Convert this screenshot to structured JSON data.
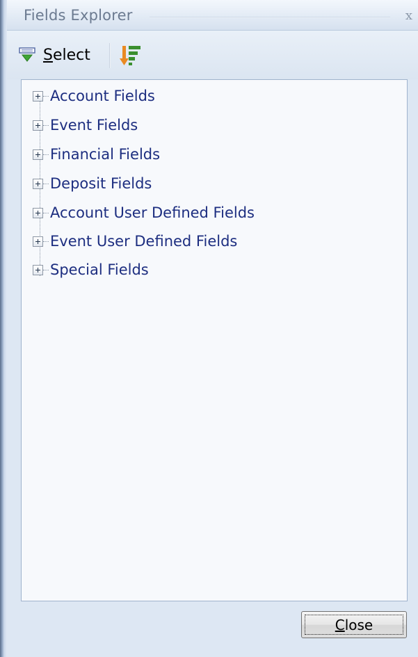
{
  "window": {
    "title": "Fields Explorer",
    "close_glyph": "x"
  },
  "toolbar": {
    "select_first": "S",
    "select_rest": "elect",
    "select_icon": "select-fields-icon",
    "sort_icon": "sort-order-icon"
  },
  "tree": {
    "items": [
      {
        "label": "Account Fields"
      },
      {
        "label": "Event Fields"
      },
      {
        "label": "Financial Fields"
      },
      {
        "label": "Deposit Fields"
      },
      {
        "label": "Account User Defined Fields"
      },
      {
        "label": "Event User Defined Fields"
      },
      {
        "label": "Special Fields"
      }
    ]
  },
  "footer": {
    "close_first": "C",
    "close_rest": "lose"
  },
  "colors": {
    "tree_text": "#1d2e80",
    "frame": "#dde7f3",
    "title_text": "#6b7a90"
  }
}
